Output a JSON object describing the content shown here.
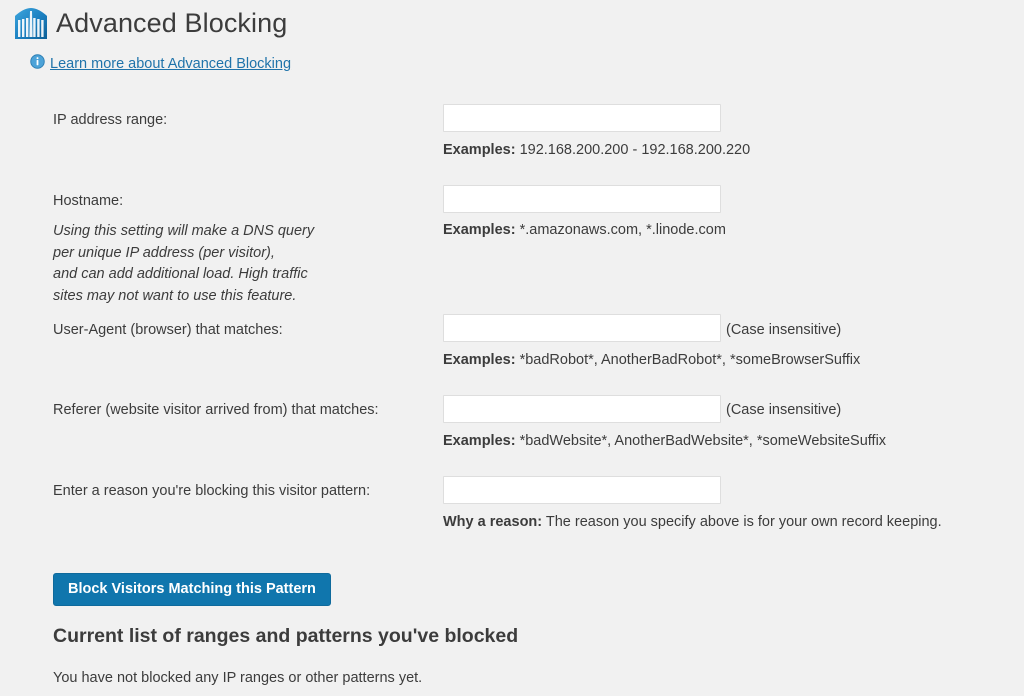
{
  "header": {
    "title": "Advanced Blocking",
    "logo_icon": "wordfence-building-icon",
    "info_icon": "info-circle-icon",
    "learn_more_label": "Learn more about Advanced Blocking",
    "link_color": "#1f73aa"
  },
  "form": {
    "rows": [
      {
        "label": "IP address range:",
        "input_value": "",
        "input_placeholder": "",
        "suffix": "",
        "example_prefix": "Examples:",
        "example_text": "192.168.200.200 - 192.168.200.220"
      },
      {
        "label": "Hostname:",
        "input_value": "",
        "input_placeholder": "",
        "suffix": "",
        "example_prefix": "Examples:",
        "example_text": "*.amazonaws.com, *.linode.com"
      },
      {
        "label": "User-Agent (browser) that matches:",
        "input_value": "",
        "input_placeholder": "",
        "suffix": "(Case insensitive)",
        "example_prefix": "Examples:",
        "example_text": "*badRobot*, AnotherBadRobot*, *someBrowserSuffix"
      },
      {
        "label": "Referer (website visitor arrived from) that matches:",
        "input_value": "",
        "input_placeholder": "",
        "suffix": "(Case insensitive)",
        "example_prefix": "Examples:",
        "example_text": "*badWebsite*, AnotherBadWebsite*, *someWebsiteSuffix"
      },
      {
        "label": "Enter a reason you're blocking this visitor pattern:",
        "input_value": "",
        "input_placeholder": "",
        "suffix": "",
        "example_prefix": "Why a reason:",
        "example_text": "The reason you specify above is for your own record keeping."
      }
    ],
    "hostname_caveat_lines": [
      "Using this setting will make a DNS query",
      "per unique IP address (per visitor),",
      "and can add additional load. High traffic",
      "sites may not want to use this feature."
    ],
    "submit_label": "Block Visitors Matching this Pattern",
    "submit_color": "#1076ad"
  },
  "blocked_list": {
    "heading": "Current list of ranges and patterns you've blocked",
    "empty_message": "You have not blocked any IP ranges or other patterns yet."
  }
}
